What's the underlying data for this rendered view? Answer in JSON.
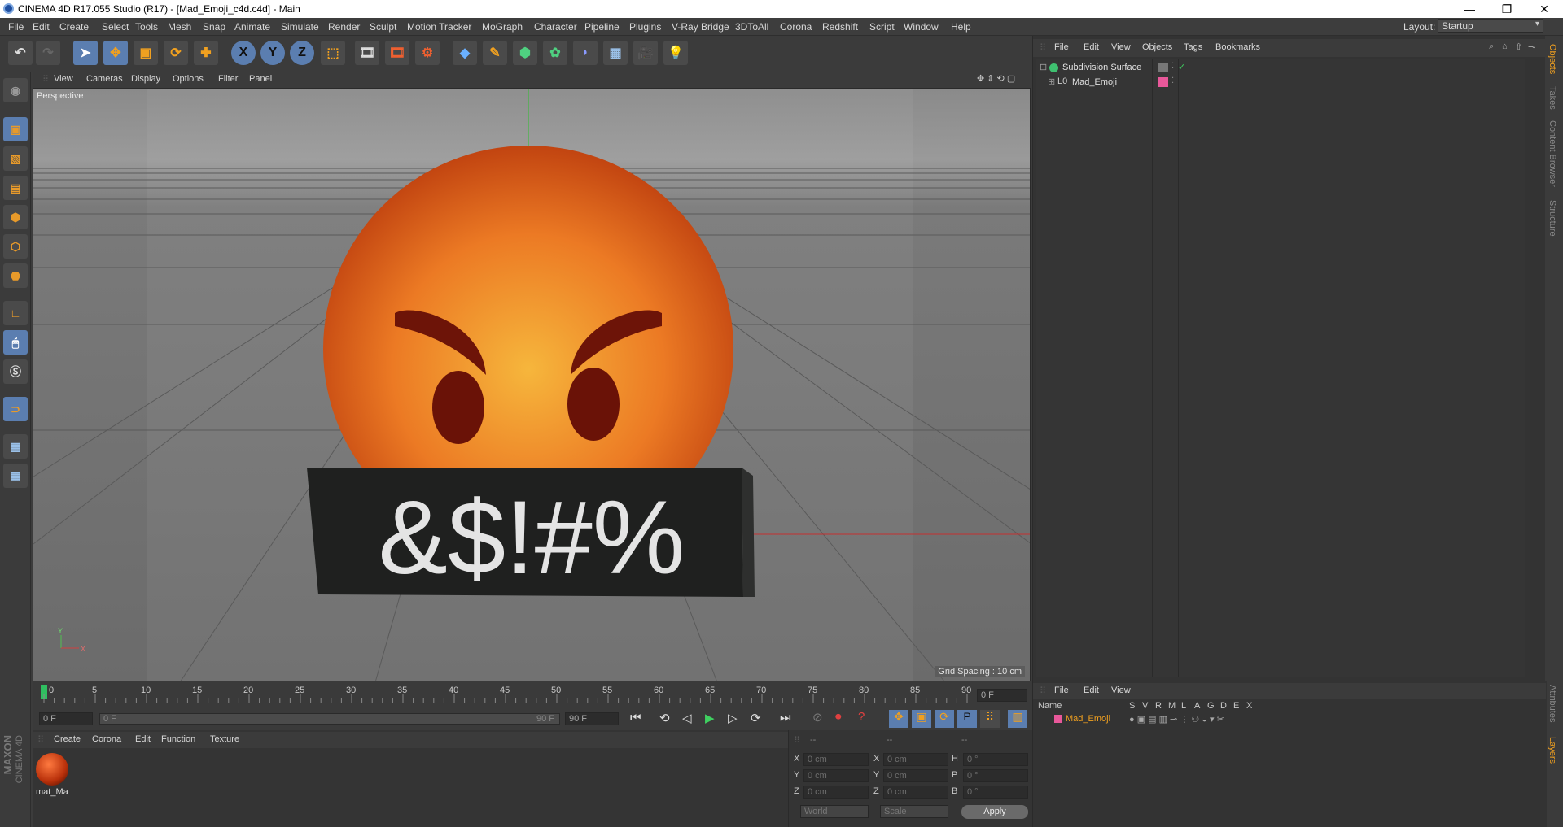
{
  "window": {
    "title": "CINEMA 4D R17.055 Studio (R17) - [Mad_Emoji_c4d.c4d] - Main",
    "minimize": "—",
    "restore": "❐",
    "close": "✕"
  },
  "menubar": {
    "items": [
      "File",
      "Edit",
      "Create",
      "Select",
      "Tools",
      "Mesh",
      "Snap",
      "Animate",
      "Simulate",
      "Render",
      "Sculpt",
      "Motion Tracker",
      "MoGraph",
      "Character",
      "Pipeline",
      "Plugins",
      "V-Ray Bridge",
      "3DToAll",
      "Corona",
      "Redshift",
      "Script",
      "Window",
      "Help"
    ],
    "layout_label": "Layout:",
    "layout_value": "Startup"
  },
  "toolbar": {
    "axis_x": "X",
    "axis_y": "Y",
    "axis_z": "Z"
  },
  "viewport": {
    "menu": [
      "View",
      "Cameras",
      "Display",
      "Options",
      "Filter",
      "Panel"
    ],
    "label": "Perspective",
    "grid_spacing": "Grid Spacing : 10 cm",
    "scene_text": "&$!#%",
    "axis_y": "Y",
    "axis_x": "X"
  },
  "object_manager": {
    "menu": [
      "File",
      "Edit",
      "View",
      "Objects",
      "Tags",
      "Bookmarks"
    ],
    "objects": [
      {
        "name": "Subdivision Surface"
      },
      {
        "name": "Mad_Emoji"
      }
    ]
  },
  "side_tabs": [
    "Objects",
    "Takes",
    "Content Browser",
    "Structure"
  ],
  "side_tabs_bottom": [
    "Attributes",
    "Layers"
  ],
  "layer_manager": {
    "menu": [
      "File",
      "Edit",
      "View"
    ],
    "columns": [
      "Name",
      "S",
      "V",
      "R",
      "M",
      "L",
      "A",
      "G",
      "D",
      "E",
      "X"
    ],
    "layers": [
      {
        "name": "Mad_Emoji"
      }
    ]
  },
  "timeline": {
    "ticks": [
      "0",
      "5",
      "10",
      "15",
      "20",
      "25",
      "30",
      "35",
      "40",
      "45",
      "50",
      "55",
      "60",
      "65",
      "70",
      "75",
      "80",
      "85",
      "90"
    ],
    "current_frame": "0 F",
    "start_frame": "0 F",
    "range_start": "0 F",
    "range_end": "90 F",
    "end_frame": "90 F"
  },
  "material_manager": {
    "menu": [
      "Create",
      "Corona",
      "Edit",
      "Function",
      "Texture"
    ],
    "materials": [
      {
        "name": "mat_Ma"
      }
    ],
    "maxon_line1": "MAXON",
    "maxon_line2": "CINEMA 4D"
  },
  "coordinates": {
    "headers": [
      "--",
      "--",
      "--"
    ],
    "rows": [
      {
        "l1": "X",
        "v1": "0 cm",
        "l2": "X",
        "v2": "0 cm",
        "l3": "H",
        "v3": "0 °"
      },
      {
        "l1": "Y",
        "v1": "0 cm",
        "l2": "Y",
        "v2": "0 cm",
        "l3": "P",
        "v3": "0 °"
      },
      {
        "l1": "Z",
        "v1": "0 cm",
        "l2": "Z",
        "v2": "0 cm",
        "l3": "B",
        "v3": "0 °"
      }
    ],
    "mode1": "World",
    "mode2": "Scale",
    "apply": "Apply"
  },
  "colors": {
    "accent_blue": "#5b7eb0",
    "layer_pink": "#e8589a",
    "emoji_orange": "#e8651f",
    "active_layer_text": "#f0a020"
  }
}
